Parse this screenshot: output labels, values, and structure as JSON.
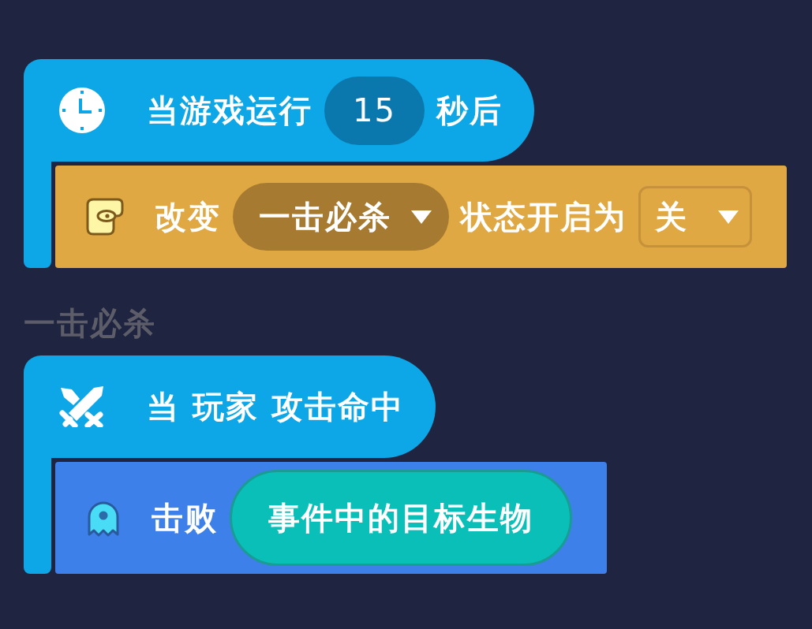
{
  "scripts": [
    {
      "trigger": {
        "kind": "timer",
        "parts": [
          {
            "kind": "text",
            "text": "当游戏运行"
          },
          {
            "kind": "number",
            "text": "15"
          },
          {
            "kind": "text",
            "text": "秒后"
          }
        ]
      },
      "actions": [
        {
          "kind": "state",
          "parts": [
            {
              "kind": "text",
              "text": "改变"
            },
            {
              "kind": "dropdown",
              "text": "一击必杀"
            },
            {
              "kind": "text",
              "text": "状态开启为"
            },
            {
              "kind": "toggle",
              "text": "关"
            }
          ]
        }
      ]
    },
    {
      "label": "一击必杀",
      "trigger": {
        "kind": "attack",
        "parts": [
          {
            "kind": "text",
            "text": "当 玩家 攻击命中"
          }
        ]
      },
      "actions": [
        {
          "kind": "defeat",
          "parts": [
            {
              "kind": "text",
              "text": "击败"
            },
            {
              "kind": "reporter",
              "text": "事件中的目标生物"
            }
          ]
        }
      ]
    }
  ]
}
